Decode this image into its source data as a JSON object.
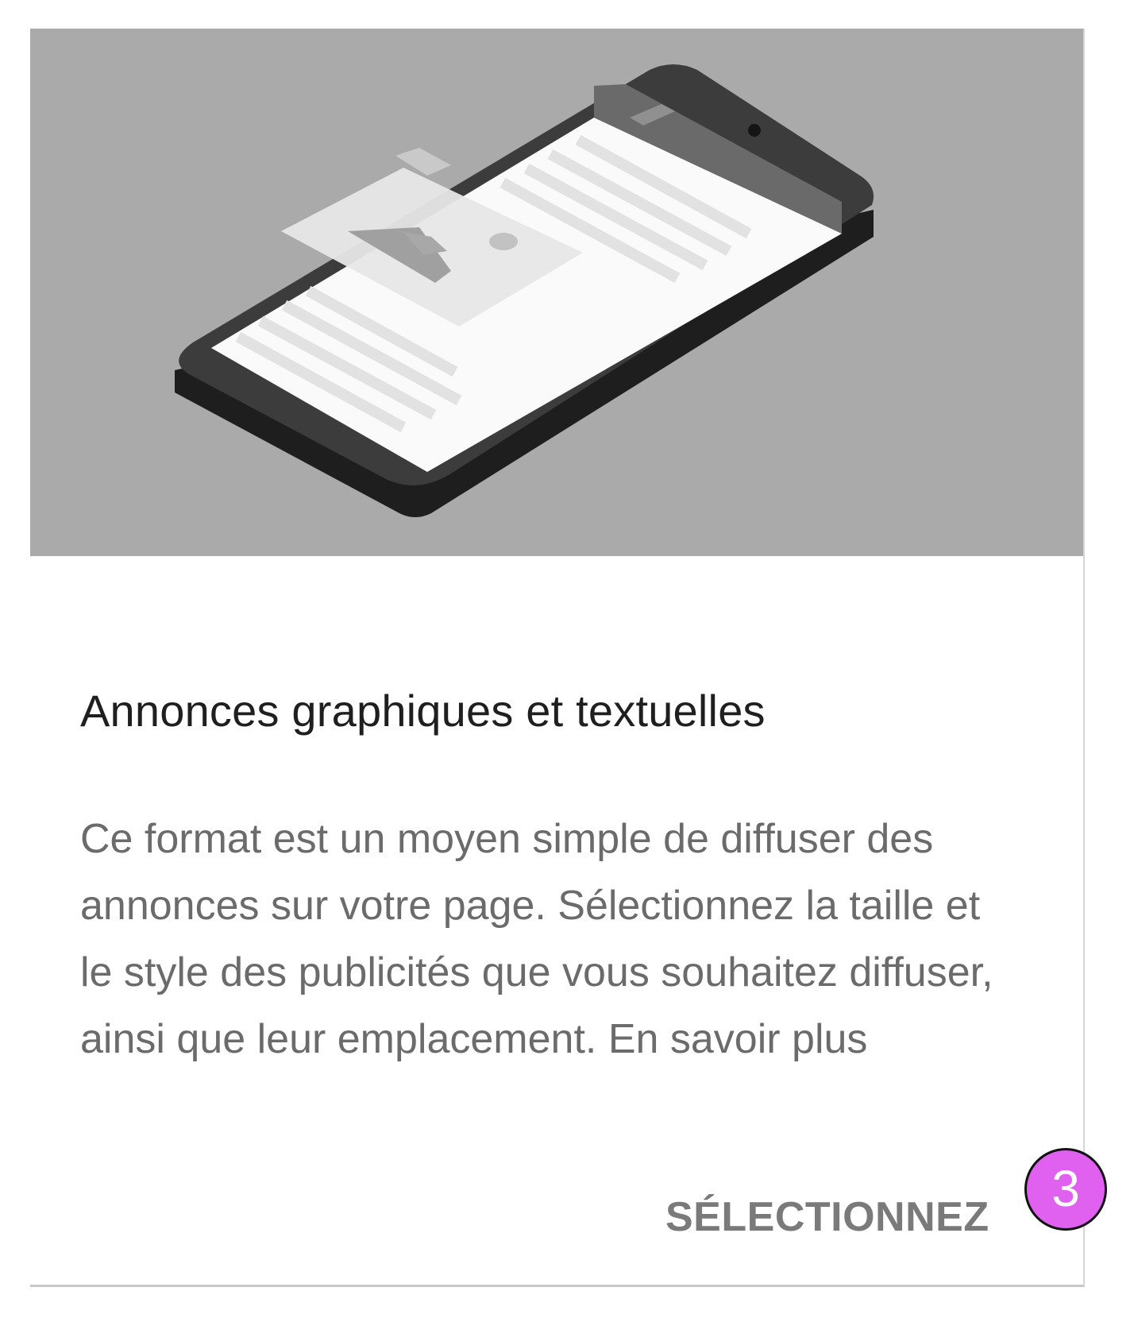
{
  "card": {
    "title": "Annonces graphiques et textuelles",
    "description": "Ce format est un moyen simple de diffuser des annonces sur votre page. Sélectionnez la taille et le style des publicités que vous souhaitez diffuser, ainsi que leur emplacement.",
    "learn_more_label": "En savoir plus",
    "select_button_label": "SÉLECTIONNEZ",
    "illustration": "phone-with-image-ad-illustration"
  },
  "annotation": {
    "step_number": "3"
  },
  "colors": {
    "hero_background": "#aaaaaa",
    "title_text": "#1f1f1f",
    "body_text": "#6b6b6b",
    "button_text": "#7a7a7a",
    "badge_fill": "#e060f0"
  }
}
